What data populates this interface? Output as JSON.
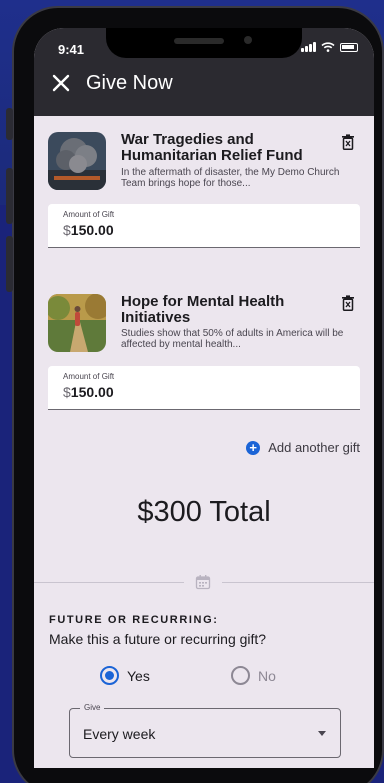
{
  "status_bar": {
    "time": "9:41"
  },
  "header": {
    "title": "Give Now",
    "close_icon": "close-icon"
  },
  "gifts": [
    {
      "title": "War Tragedies and Humanitarian Relief Fund",
      "description": "In the aftermath of disaster, the My Demo Church Team brings hope for those...",
      "amount_label": "Amount of Gift",
      "currency": "$",
      "amount": "150.00",
      "delete_icon": "trash-icon"
    },
    {
      "title": "Hope for Mental Health Initiatives",
      "description": "Studies show that 50% of adults in America will be affected by mental health...",
      "amount_label": "Amount of Gift",
      "currency": "$",
      "amount": "150.00",
      "delete_icon": "trash-icon"
    }
  ],
  "add_gift": {
    "label": "Add another gift",
    "icon": "plus-circle-icon"
  },
  "total": {
    "text": "$300 Total"
  },
  "recurring": {
    "heading": "FUTURE OR RECURRING:",
    "question": "Make this a future or recurring gift?",
    "options": [
      {
        "label": "Yes",
        "selected": true
      },
      {
        "label": "No",
        "selected": false
      }
    ],
    "select": {
      "legend": "Give",
      "value": "Every week"
    }
  },
  "colors": {
    "appbar": "#2b2a30",
    "screen_bg": "#ece6ee",
    "accent": "#1b64d6",
    "page_bg": "#1b2a7a"
  }
}
